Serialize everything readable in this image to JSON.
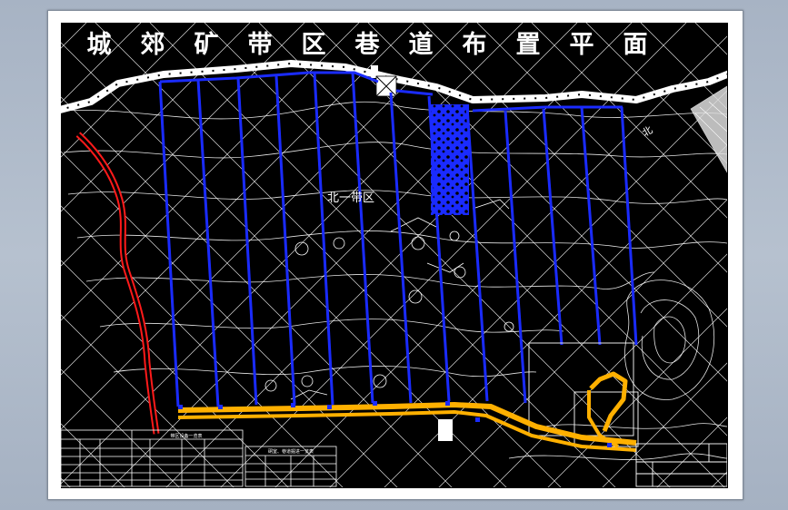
{
  "drawing": {
    "title": "城郊矿带区巷道布置平面",
    "zone_label": "北一带区",
    "north_label": "北"
  },
  "tables": {
    "equipment_title": "带区设备一览表",
    "chamber_title": "硐室、巷道掘进一览表"
  },
  "colors": {
    "background": "#000000",
    "roadway_blue": "#1a2bff",
    "haulage_orange": "#ffb000",
    "river_red": "#ff1a1a",
    "contour_white": "#ffffff",
    "boundary_white": "#ffffff"
  }
}
